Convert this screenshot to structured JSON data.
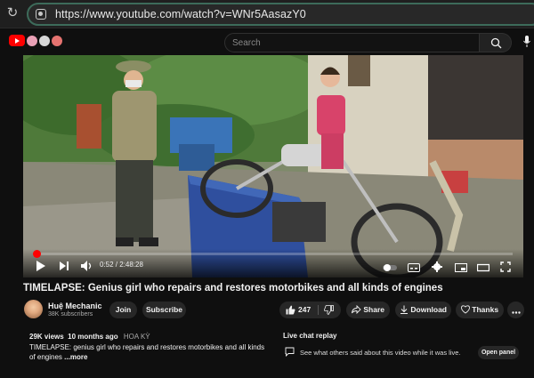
{
  "browser": {
    "url": "https://www.youtube.com/watch?v=WNr5AasazY0"
  },
  "header": {
    "search_placeholder": "Search"
  },
  "video": {
    "time_display": "0:52 / 2:48:28",
    "progress_fraction": 0.0051
  },
  "info": {
    "title": "TIMELAPSE: Genius girl who repairs and restores motorbikes and all kinds of engines",
    "channel_name": "Huệ Mechanic",
    "subscribers": "38K subscribers",
    "join_label": "Join",
    "subscribe_label": "Subscribe",
    "likes": "247",
    "share_label": "Share",
    "download_label": "Download",
    "thanks_label": "Thanks"
  },
  "description": {
    "views": "29K views",
    "age": "10 months ago",
    "tag": "HOA KỲ",
    "text": "TIMELAPSE: genius girl who repairs and restores motorbikes and all kinds of engines",
    "more_label": "...more"
  },
  "live_chat": {
    "title": "Live chat replay",
    "message": "See what others said about this video while it was live.",
    "open_label": "Open panel"
  }
}
